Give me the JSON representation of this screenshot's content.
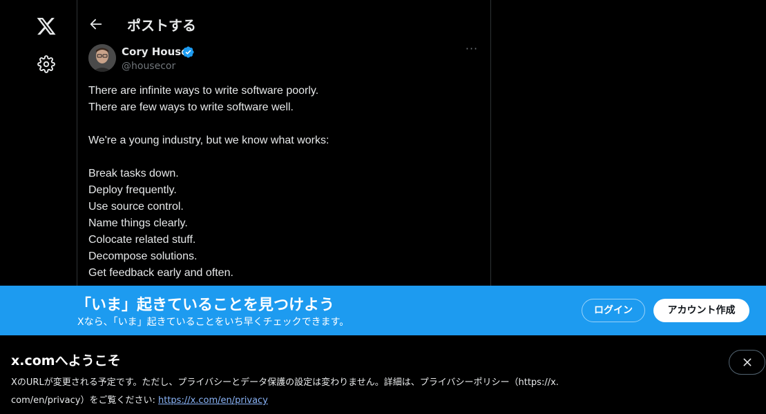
{
  "header": {
    "title": "ポストする"
  },
  "nav": {
    "logo_icon": "x-logo-icon",
    "settings_icon": "gear-icon"
  },
  "post": {
    "author_name": "Cory House",
    "author_handle": "@housecor",
    "verified": true,
    "lines": [
      "There are infinite ways to write software poorly.",
      "There are few ways to write software well.",
      "",
      "We're a young industry, but we know what works:",
      "",
      "Break tasks down.",
      "Deploy frequently.",
      "Use source control.",
      "Name things clearly.",
      "Colocate related stuff.",
      "Decompose solutions.",
      "Get feedback early and often."
    ]
  },
  "banner": {
    "title": "「いま」起きていることを見つけよう",
    "subtitle": "Xなら、「いま」起きていることをいち早くチェックできます。",
    "login_label": "ログイン",
    "signup_label": "アカウント作成"
  },
  "notice": {
    "title": "x.comへようこそ",
    "text_line1": "XのURLが変更される予定です。ただし、プライバシーとデータ保護の設定は変わりません。詳細は、プライバシーポリシー（https://x.",
    "text_line2_prefix": "com/en/privacy）をご覧ください: ",
    "link_text": "https://x.com/en/privacy"
  },
  "colors": {
    "accent": "#1d9bf0",
    "background": "#000000",
    "verified": "#1d9bf0",
    "link": "#8ab4f8"
  }
}
